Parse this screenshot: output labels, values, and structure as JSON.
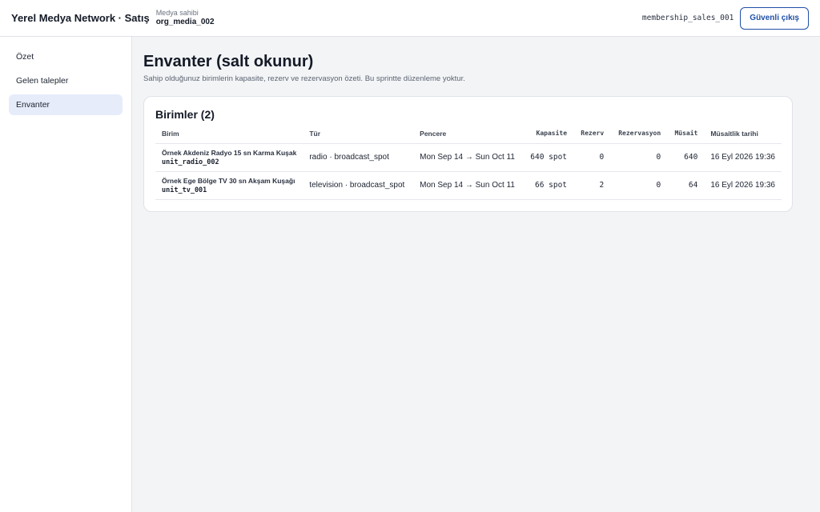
{
  "header": {
    "brand": "Yerel Medya Network · Satış",
    "org_caption": "Medya sahibi",
    "org_value": "org_media_002",
    "user_id": "membership_sales_001",
    "logout_label": "Güvenli çıkış"
  },
  "sidebar": {
    "items": [
      {
        "label": "Özet"
      },
      {
        "label": "Gelen talepler"
      },
      {
        "label": "Envanter"
      }
    ],
    "active_index": 2
  },
  "main": {
    "title": "Envanter (salt okunur)",
    "subtitle": "Sahip olduğunuz birimlerin kapasite, rezerv ve rezervasyon özeti. Bu sprintte düzenleme yoktur.",
    "card_title": "Birimler (2)",
    "columns": {
      "unit": "Birim",
      "type": "Tür",
      "window": "Pencere",
      "capacity": "Kapasite",
      "reserve": "Rezerv",
      "reservation": "Rezervasyon",
      "available": "Müsait",
      "available_date": "Müsaitlik tarihi"
    },
    "rows": [
      {
        "name": "Örnek Akdeniz Radyo 15 sn Karma Kuşak",
        "id": "unit_radio_002",
        "type": "radio · broadcast_spot",
        "window": "Mon Sep 14 → Sun Oct 11",
        "capacity": "640 spot",
        "reserve": "0",
        "reservation": "0",
        "available": "640",
        "available_date": "16 Eyl 2026 19:36"
      },
      {
        "name": "Örnek Ege Bölge TV 30 sn Akşam Kuşağı",
        "id": "unit_tv_001",
        "type": "television · broadcast_spot",
        "window": "Mon Sep 14 → Sun Oct 11",
        "capacity": "66 spot",
        "reserve": "2",
        "reservation": "0",
        "available": "64",
        "available_date": "16 Eyl 2026 19:36"
      }
    ]
  }
}
